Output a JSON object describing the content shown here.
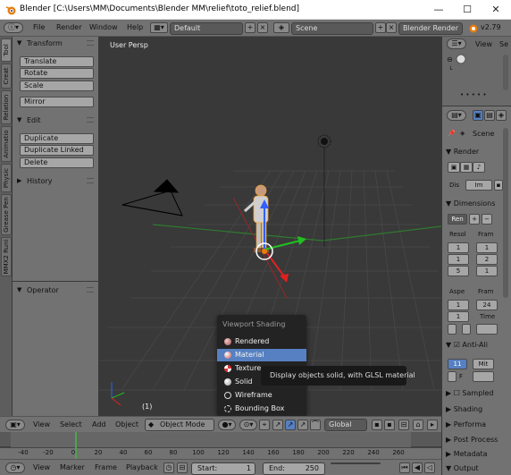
{
  "window": {
    "title": "Blender  [C:\\Users\\MM\\Documents\\Blender MM\\relief\\toto_relief.blend]",
    "minimize": "—",
    "maximize": "☐",
    "close": "✕"
  },
  "info_header": {
    "menus": [
      "File",
      "Render",
      "Window",
      "Help"
    ],
    "layout": "Default",
    "scene": "Scene",
    "engine": "Blender Render",
    "version": "v2.79"
  },
  "tool_tabs": [
    "Tool",
    "Creat",
    "Relation",
    "Animatio",
    "Physic",
    "Grease Pen",
    "MMX2 Runi"
  ],
  "tool_shelf": {
    "transform": {
      "title": "Transform",
      "buttons": [
        "Translate",
        "Rotate",
        "Scale"
      ],
      "mirror": "Mirror"
    },
    "edit": {
      "title": "Edit",
      "buttons": [
        "Duplicate",
        "Duplicate Linked",
        "Delete"
      ]
    },
    "history_title": "History",
    "operator_title": "Operator"
  },
  "viewport": {
    "label": "User Persp",
    "frame_label": "(1)"
  },
  "shading_menu": {
    "title": "Viewport Shading",
    "items": [
      {
        "label": "Rendered",
        "icon": "rendered-icon",
        "selected": false
      },
      {
        "label": "Material",
        "icon": "material-icon",
        "selected": true
      },
      {
        "label": "Texture",
        "icon": "texture-icon",
        "selected": false
      },
      {
        "label": "Solid",
        "icon": "solid-icon",
        "selected": false
      },
      {
        "label": "Wireframe",
        "icon": "wireframe-icon",
        "selected": false
      },
      {
        "label": "Bounding Box",
        "icon": "bounding-box-icon",
        "selected": false
      }
    ],
    "tooltip": "Display objects solid, with GLSL material"
  },
  "view_header": {
    "menus": [
      "View",
      "Select",
      "Add",
      "Object"
    ],
    "mode": "Object Mode",
    "orientation": "Global"
  },
  "timeline": {
    "ticks": [
      "-40",
      "-20",
      "0",
      "20",
      "40",
      "60",
      "80",
      "100",
      "120",
      "140",
      "160",
      "180",
      "200",
      "220",
      "240",
      "260"
    ],
    "current_frame": "1"
  },
  "time_header": {
    "menus": [
      "View",
      "Marker",
      "Frame",
      "Playback"
    ],
    "start_label": "Start:",
    "start_value": "1",
    "end_label": "End:",
    "end_value": "250",
    "current": "1"
  },
  "outliner": {
    "view_label": "View",
    "search_label": "Se"
  },
  "properties": {
    "context": "Scene",
    "render_title": "Render",
    "display_label": "Dis",
    "display_value": "Im",
    "dimensions_title": "Dimensions",
    "preset_label": "Ren",
    "resolution_label": "Resol",
    "frame_label": "Fram",
    "res_values": [
      "1",
      "1",
      "5"
    ],
    "frame_values": [
      "1",
      "2",
      "1"
    ],
    "aspect_label": "Aspe",
    "frame_rate_label": "Fram",
    "aspect_values": [
      "1",
      "1"
    ],
    "fps_value": "24",
    "time_label": "Time",
    "anti_alias": "Anti-Ali",
    "aa_values": [
      "11",
      "Mit"
    ],
    "f_label": "F",
    "sampled": "Sampled",
    "shading": "Shading",
    "performance": "Performa",
    "post_processing": "Post Process",
    "metadata": "Metadata",
    "output": "Output"
  }
}
